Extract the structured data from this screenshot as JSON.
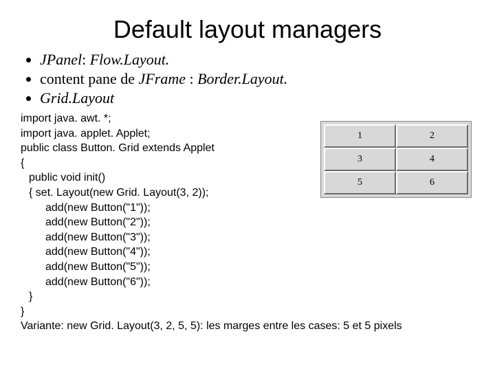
{
  "title": "Default layout managers",
  "bullets": [
    {
      "prefix": "JPanel",
      "sep": ": ",
      "suffix": "Flow.Layout.",
      "prefix_italic": true,
      "suffix_italic": true
    },
    {
      "prefix": " content pane de ",
      "mid": "JFrame",
      "sep2": " : ",
      "suffix": "Border.Layout.",
      "mid_italic": true,
      "suffix_italic": true
    },
    {
      "prefix": "Grid.Layout",
      "prefix_italic": true
    }
  ],
  "code": {
    "l1": "import java. awt. *;",
    "l2": "import java. applet. Applet;",
    "l3": "public class Button. Grid extends Applet",
    "l4": "{",
    "l5": "public void init()",
    "l6": "{ set. Layout(new Grid. Layout(3, 2));",
    "l7": "add(new Button(\"1\"));",
    "l8": "add(new Button(\"2\"));",
    "l9": "add(new Button(\"3\"));",
    "l10": "add(new Button(\"4\"));",
    "l11": "add(new Button(\"5\"));",
    "l12": "add(new Button(\"6\"));",
    "l13": "}",
    "l14": "}"
  },
  "grid_buttons": [
    "1",
    "2",
    "3",
    "4",
    "5",
    "6"
  ],
  "variant_pre": "Variante: new Grid. Layout(3, 2, ",
  "variant_hl": "5, 5",
  "variant_post": "): les marges entre les cases: 5 et 5 pixels"
}
